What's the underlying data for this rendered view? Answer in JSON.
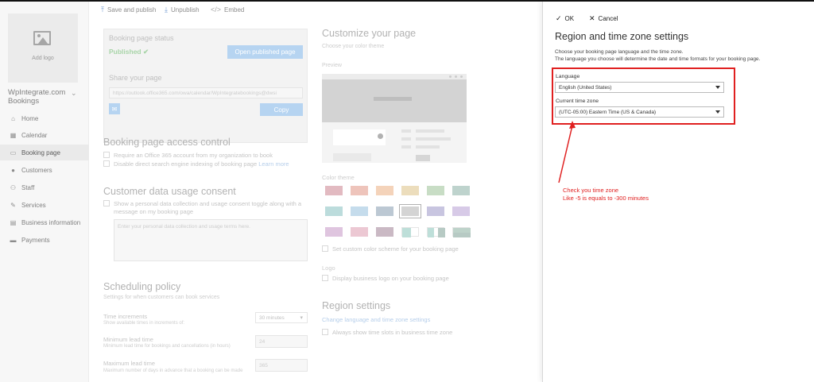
{
  "toolbar": {
    "save_publish": "Save and publish",
    "unpublish": "Unpublish",
    "embed": "Embed"
  },
  "sidebar": {
    "add_logo": "Add logo",
    "business_name": "WpIntegrate.com Bookings",
    "items": [
      {
        "label": "Home",
        "icon": "home-icon"
      },
      {
        "label": "Calendar",
        "icon": "calendar-icon"
      },
      {
        "label": "Booking page",
        "icon": "monitor-icon",
        "active": true
      },
      {
        "label": "Customers",
        "icon": "person-icon"
      },
      {
        "label": "Staff",
        "icon": "people-icon"
      },
      {
        "label": "Services",
        "icon": "wrench-icon"
      },
      {
        "label": "Business information",
        "icon": "briefcase-icon"
      },
      {
        "label": "Payments",
        "icon": "card-icon"
      }
    ]
  },
  "booking_status": {
    "title": "Booking page status",
    "status": "Published",
    "open_button": "Open published page",
    "share_title": "Share your page",
    "share_url": "https://outlook.office365.com/owa/calendar/WpIntegratebookings@dwsi",
    "copy_button": "Copy"
  },
  "access_control": {
    "title": "Booking page access control",
    "opt1": "Require an Office 365 account from my organization to book",
    "opt2": "Disable direct search engine indexing of booking page",
    "learn_more": "Learn more"
  },
  "consent": {
    "title": "Customer data usage consent",
    "opt": "Show a personal data collection and usage consent toggle along with a message on my booking page",
    "placeholder": "Enter your personal data collection and usage terms here."
  },
  "scheduling": {
    "title": "Scheduling policy",
    "subtitle": "Settings for when customers can book services",
    "time_increments": "Time increments",
    "time_increments_sub": "Show available times in increments of:",
    "time_increments_value": "30 minutes",
    "min_lead": "Minimum lead time",
    "min_lead_sub": "Minimum lead time for bookings and cancellations (in hours)",
    "min_lead_value": "24",
    "max_lead": "Maximum lead time",
    "max_lead_sub": "Maximum number of days in advance that a booking can be made",
    "max_lead_value": "365"
  },
  "customize": {
    "title": "Customize your page",
    "subtitle": "Choose your color theme",
    "preview": "Preview",
    "color_theme": "Color theme",
    "custom_scheme": "Set custom color scheme for your booking page",
    "logo": "Logo",
    "display_logo": "Display business logo on your booking page",
    "swatch_colors": [
      "#d9a3ad",
      "#e8b0a5",
      "#f0c4a3",
      "#e6d2a6",
      "#b6d2b2",
      "#a9c4bd",
      "#a6d0d0",
      "#b2d1e6",
      "#a6b6c4",
      "#c6c6c6",
      "#b6b2d6",
      "#cab9df",
      "#d4b2d4",
      "#e6b6c4",
      "#b9a2b1",
      "#a9d4cc",
      "#a9d4cc",
      "#a9c4b9"
    ]
  },
  "region": {
    "title": "Region settings",
    "link": "Change language and time zone settings",
    "always_show": "Always show time slots in business time zone"
  },
  "panel": {
    "ok": "OK",
    "cancel": "Cancel",
    "title": "Region and time zone settings",
    "desc1": "Choose your booking page language and the time zone.",
    "desc2": "The language you choose will determine the date and time formats for your booking page.",
    "language_label": "Language",
    "language_value": "English (United States)",
    "timezone_label": "Current time zone",
    "timezone_value": "(UTC-05:00) Eastern Time (US & Canada)"
  },
  "annotation": {
    "line1": "Check you time zone",
    "line2": "Like -5 is equals to -300 minutes",
    "color": "#e02020"
  }
}
